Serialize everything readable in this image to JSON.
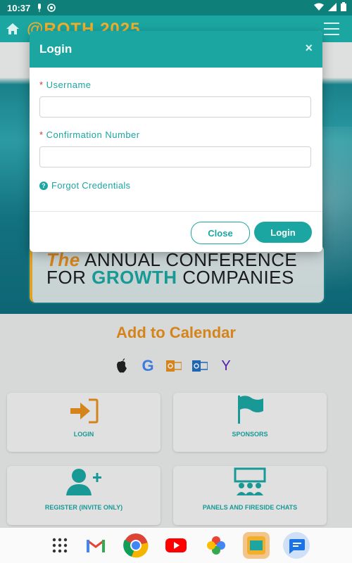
{
  "status_bar": {
    "time": "10:37"
  },
  "header": {
    "logo_text": "@ROTH 2025"
  },
  "hero": {
    "line1_prefix": "The",
    "line1_rest": " ANNUAL CONFERENCE",
    "line2_prefix": "FOR ",
    "line2_highlight": "GROWTH",
    "line2_rest": " COMPANIES"
  },
  "calendar": {
    "title": "Add to Calendar",
    "icons": [
      "apple-icon",
      "google-icon",
      "outlook-icon",
      "outlook-com-icon",
      "yahoo-icon"
    ],
    "google_letter": "G",
    "yahoo_letter": "Y"
  },
  "tiles": [
    {
      "label": "LOGIN"
    },
    {
      "label": "SPONSORS"
    },
    {
      "label": "REGISTER (INVITE ONLY)"
    },
    {
      "label": "PANELS AND FIRESIDE CHATS"
    }
  ],
  "modal": {
    "title": "Login",
    "close_symbol": "×",
    "required_mark": "*",
    "username_label": "Username",
    "username_value": "",
    "confirmation_label": "Confirmation Number",
    "confirmation_value": "",
    "forgot_label": "Forgot Credentials",
    "forgot_icon_glyph": "?",
    "close_button": "Close",
    "login_button": "Login"
  },
  "colors": {
    "teal": "#1ba6a2",
    "orange": "#e8901f",
    "gold": "#f2b02a",
    "required": "#d9382f"
  }
}
